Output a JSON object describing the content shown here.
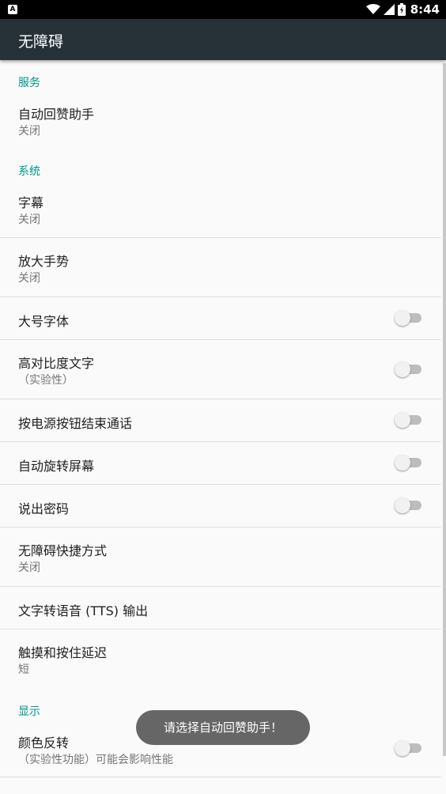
{
  "status_bar": {
    "app_icon_letter": "A",
    "time": "8:44",
    "icons": [
      "wifi-icon",
      "signal-icon",
      "battery-icon"
    ]
  },
  "app_bar": {
    "title": "无障碍"
  },
  "sections": {
    "services": {
      "header": "服务",
      "items": [
        {
          "title": "自动回赞助手",
          "summary": "关闭"
        }
      ]
    },
    "system": {
      "header": "系统",
      "items": [
        {
          "title": "字幕",
          "summary": "关闭"
        },
        {
          "title": "放大手势",
          "summary": "关闭"
        },
        {
          "title": "大号字体",
          "switch_on": false
        },
        {
          "title": "高对比度文字",
          "summary": "（实验性）",
          "switch_on": false
        },
        {
          "title": "按电源按钮结束通话",
          "switch_on": false
        },
        {
          "title": "自动旋转屏幕",
          "switch_on": false
        },
        {
          "title": "说出密码",
          "switch_on": false
        },
        {
          "title": "无障碍快捷方式",
          "summary": "关闭"
        },
        {
          "title": "文字转语音 (TTS) 输出"
        },
        {
          "title": "触摸和按住延迟",
          "summary": "短"
        }
      ]
    },
    "display": {
      "header": "显示",
      "items": [
        {
          "title": "颜色反转",
          "summary": "（实验性功能）可能会影响性能",
          "switch_on": false
        }
      ]
    }
  },
  "toast": {
    "message": "请选择自动回赞助手！"
  },
  "colors": {
    "app_bar": "#263238",
    "accent": "#009688",
    "switch_off_track": "#bdbdbd",
    "switch_off_thumb": "#f1f1f1"
  }
}
